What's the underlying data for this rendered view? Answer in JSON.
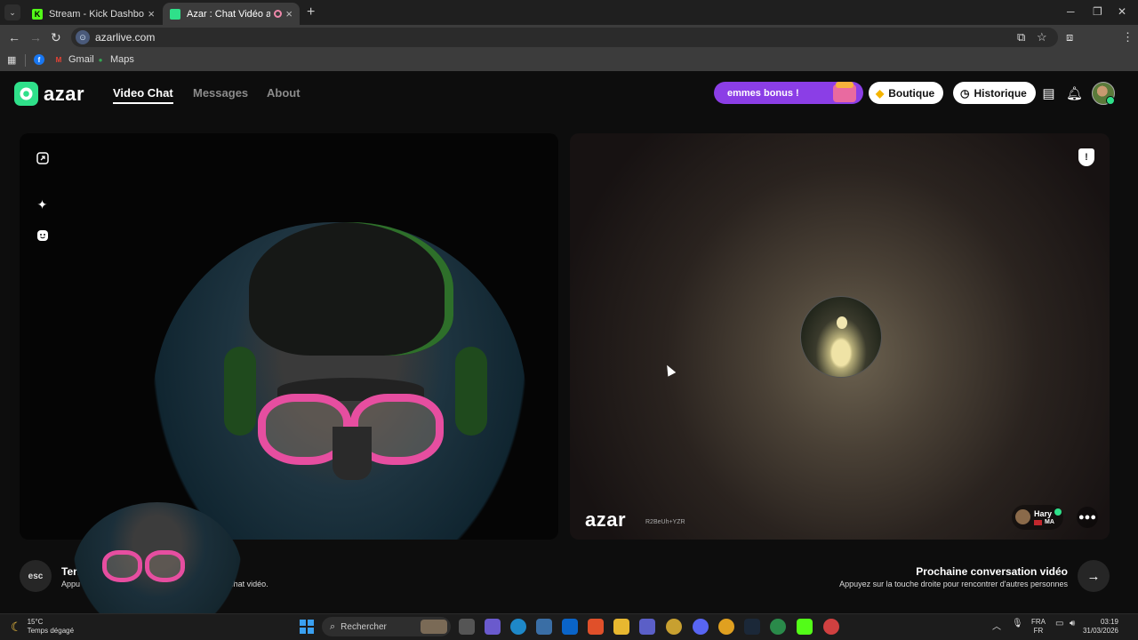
{
  "browser": {
    "tabs": [
      {
        "title": "Stream - Kick Dashboard",
        "active": false
      },
      {
        "title": "Azar : Chat Vidéo avec de n",
        "active": true
      }
    ],
    "url": "azarlive.com",
    "bookmarks": [
      "Gmail",
      "Maps"
    ]
  },
  "site": {
    "logo_text": "azar",
    "nav": [
      "Video Chat",
      "Messages",
      "About"
    ],
    "promo_text": "emmes bonus !",
    "shop_label": "Boutique",
    "history_label": "Historique"
  },
  "peer": {
    "name": "Hary",
    "country": "MA",
    "watermark_id": "R2BeUh+YZR"
  },
  "footer": {
    "esc_key": "esc",
    "end_title": "Termir",
    "end_title_tail": "éo",
    "end_hint": "Appu",
    "end_hint_tail": "fin au chat vidéo.",
    "next_title": "Prochaine conversation vidéo",
    "next_hint": "Appuyez sur la touche droite pour rencontrer d'autres personnes"
  },
  "taskbar": {
    "temperature": "15°C",
    "weather_text": "Temps dégagé",
    "search_placeholder": "Rechercher",
    "lang_top": "FRA",
    "lang_bottom": "FR",
    "time": "03:19",
    "date": "31/03/2026"
  },
  "colors": {
    "brand_green": "#2fe08a",
    "promo_purple": "#8b3ee6",
    "mask_pink": "#e64ea0"
  }
}
